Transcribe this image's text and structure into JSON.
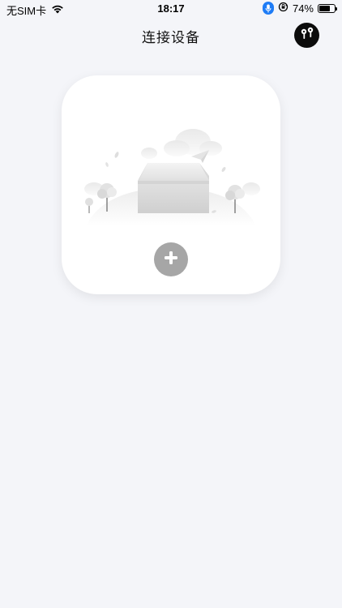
{
  "status_bar": {
    "carrier": "无SIM卡",
    "time": "18:17",
    "battery_percent": "74%",
    "battery_level": 0.74
  },
  "nav": {
    "title": "连接设备",
    "right_icon": "earbuds-icon"
  },
  "card": {
    "illustration": "empty-box-illustration",
    "add_icon": "plus-icon"
  },
  "colors": {
    "background": "#f4f5f9",
    "card": "#ffffff",
    "add_button": "#a6a6a6",
    "mic_indicator": "#1e7cf6"
  }
}
